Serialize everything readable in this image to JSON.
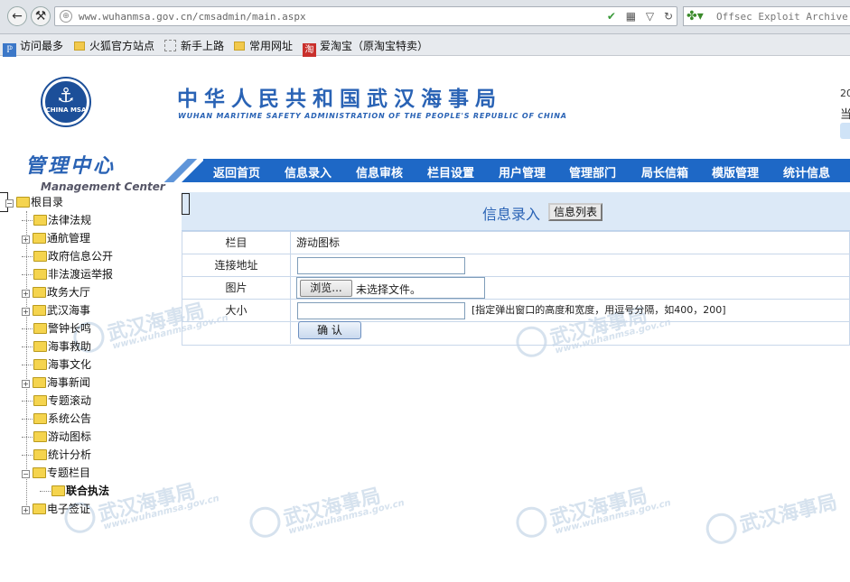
{
  "browser": {
    "url": "www.wuhanmsa.gov.cn/cmsadmin/main.aspx",
    "search_text": "Offsec Exploit Archive Se",
    "bookmarks": [
      "访问最多",
      "火狐官方站点",
      "新手上路",
      "常用网址",
      "爱淘宝（原淘宝特卖）"
    ],
    "bookmark_badge": "淘"
  },
  "header": {
    "emblem_text": "CHINA MSA",
    "title": "中华人民共和国武汉海事局",
    "subtitle": "WUHAN MARITIME SAFETY ADMINISTRATION OF THE PEOPLE'S REPUBLIC OF CHINA",
    "right_line1": "20",
    "right_line2": "当",
    "management_title": "管理中心",
    "management_subtitle": "Management Center"
  },
  "nav": {
    "items": [
      "返回首页",
      "信息录入",
      "信息审核",
      "栏目设置",
      "用户管理",
      "管理部门",
      "局长信箱",
      "模版管理",
      "统计信息"
    ]
  },
  "tree": {
    "root": "根目录",
    "items": [
      {
        "label": "法律法规",
        "expandable": false
      },
      {
        "label": "通航管理",
        "expandable": true
      },
      {
        "label": "政府信息公开",
        "expandable": false
      },
      {
        "label": "非法渡运举报",
        "expandable": false
      },
      {
        "label": "政务大厅",
        "expandable": true
      },
      {
        "label": "武汉海事",
        "expandable": true
      },
      {
        "label": "警钟长鸣",
        "expandable": false
      },
      {
        "label": "海事救助",
        "expandable": false
      },
      {
        "label": "海事文化",
        "expandable": false
      },
      {
        "label": "海事新闻",
        "expandable": true
      },
      {
        "label": "专题滚动",
        "expandable": false
      },
      {
        "label": "系统公告",
        "expandable": false
      },
      {
        "label": "游动图标",
        "expandable": false
      },
      {
        "label": "统计分析",
        "expandable": false
      },
      {
        "label": "专题栏目",
        "expandable": true
      },
      {
        "label": "电子签证",
        "expandable": true
      }
    ],
    "child_item": "联合执法"
  },
  "content": {
    "title": "信息录入",
    "list_button": "信息列表",
    "form": {
      "column_label": "栏目",
      "column_value": "游动图标",
      "link_label": "连接地址",
      "link_value": "",
      "image_label": "图片",
      "browse_button": "浏览...",
      "no_file": "未选择文件。",
      "size_label": "大小",
      "size_value": "",
      "size_hint": "[指定弹出窗口的高度和宽度，用逗号分隔，如400，200]",
      "submit": "确 认"
    }
  },
  "watermark": {
    "text": "武汉海事局",
    "url": "www.wuhanmsa.gov.cn"
  }
}
